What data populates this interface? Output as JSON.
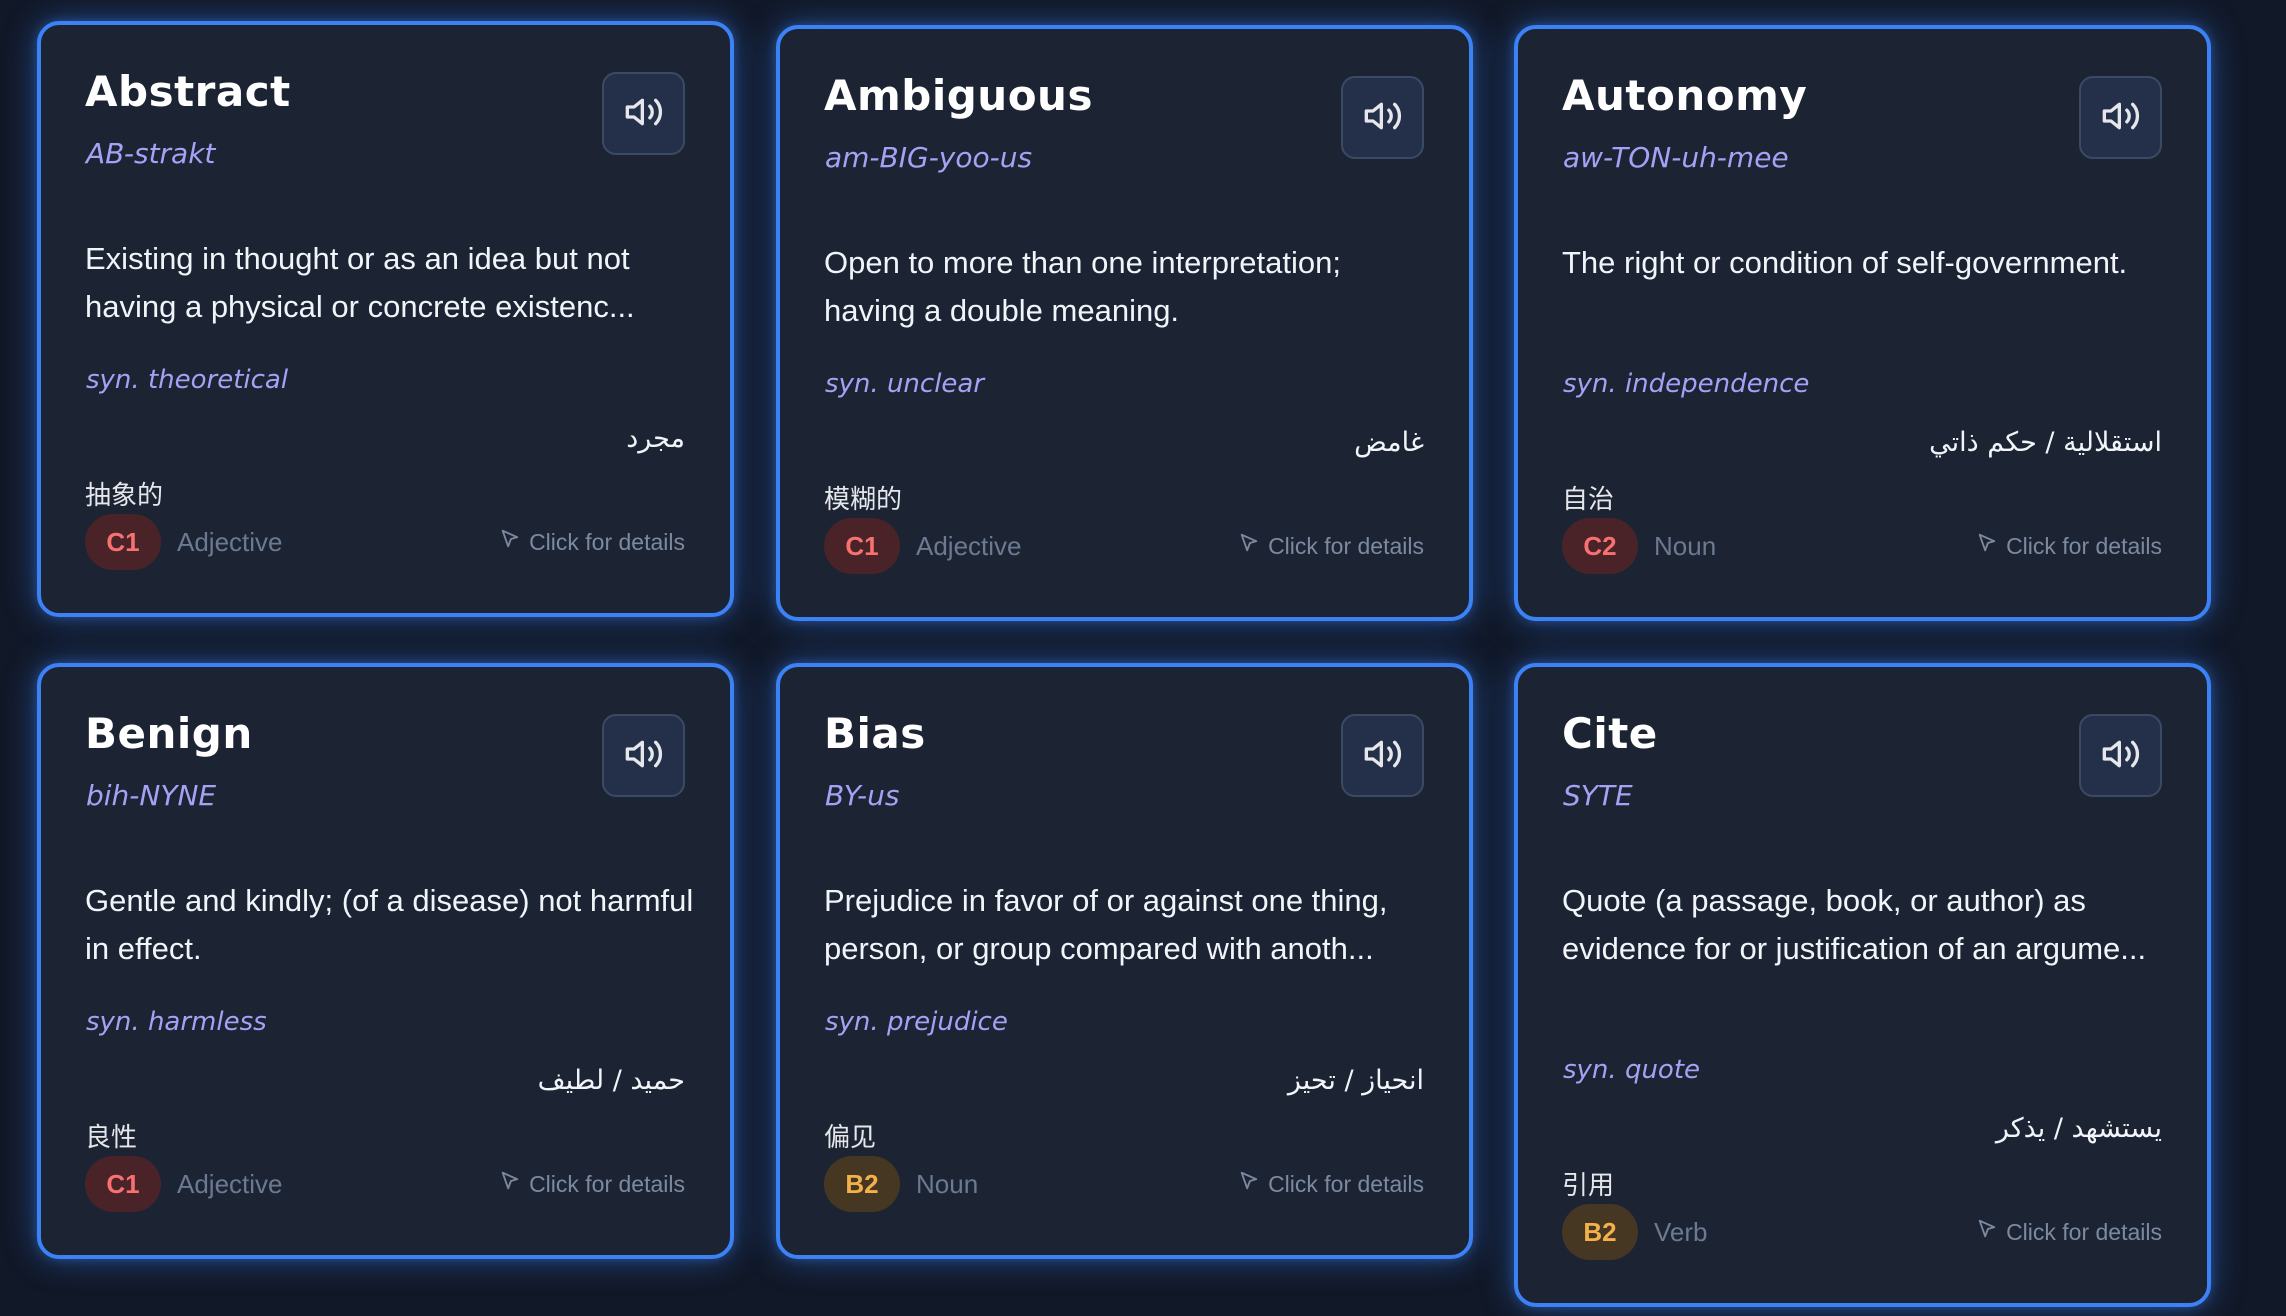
{
  "audio_icon": "speaker-icon",
  "details_icon": "pointer-icon",
  "colors": {
    "card_border": "#3b82f6",
    "card_bg": "#1c2434",
    "pronunciation": "#a5a2f5",
    "level_c": "#f87171",
    "level_b": "#f5b04a"
  },
  "cards": [
    {
      "word": "Abstract",
      "pronunciation": "AB-strakt",
      "definition": "Existing in thought or as an idea but not having a physical or concrete existenc...",
      "synonym": "syn. theoretical",
      "arabic": "مجرد",
      "chinese": "抽象的",
      "level": "C1",
      "part_of_speech": "Adjective",
      "details_label": "Click for details"
    },
    {
      "word": "Ambiguous",
      "pronunciation": "am-BIG-yoo-us",
      "definition": "Open to more than one interpretation; having a double meaning.",
      "synonym": "syn. unclear",
      "arabic": "غامض",
      "chinese": "模糊的",
      "level": "C1",
      "part_of_speech": "Adjective",
      "details_label": "Click for details"
    },
    {
      "word": "Autonomy",
      "pronunciation": "aw-TON-uh-mee",
      "definition": "The right or condition of self-government.",
      "synonym": "syn. independence",
      "arabic": "استقلالية / حكم ذاتي",
      "chinese": "自治",
      "level": "C2",
      "part_of_speech": "Noun",
      "details_label": "Click for details"
    },
    {
      "word": "Benign",
      "pronunciation": "bih-NYNE",
      "definition": "Gentle and kindly; (of a disease) not harmful in effect.",
      "synonym": "syn. harmless",
      "arabic": "حميد / لطيف",
      "chinese": "良性",
      "level": "C1",
      "part_of_speech": "Adjective",
      "details_label": "Click for details"
    },
    {
      "word": "Bias",
      "pronunciation": "BY-us",
      "definition": "Prejudice in favor of or against one thing, person, or group compared with anoth...",
      "synonym": "syn. prejudice",
      "arabic": "انحياز / تحيز",
      "chinese": "偏见",
      "level": "B2",
      "part_of_speech": "Noun",
      "details_label": "Click for details"
    },
    {
      "word": "Cite",
      "pronunciation": "SYTE",
      "definition": "Quote (a passage, book, or author) as evidence for or justification of an argume...",
      "synonym": "syn. quote",
      "arabic": "يستشهد / يذكر",
      "chinese": "引用",
      "level": "B2",
      "part_of_speech": "Verb",
      "details_label": "Click for details"
    }
  ]
}
